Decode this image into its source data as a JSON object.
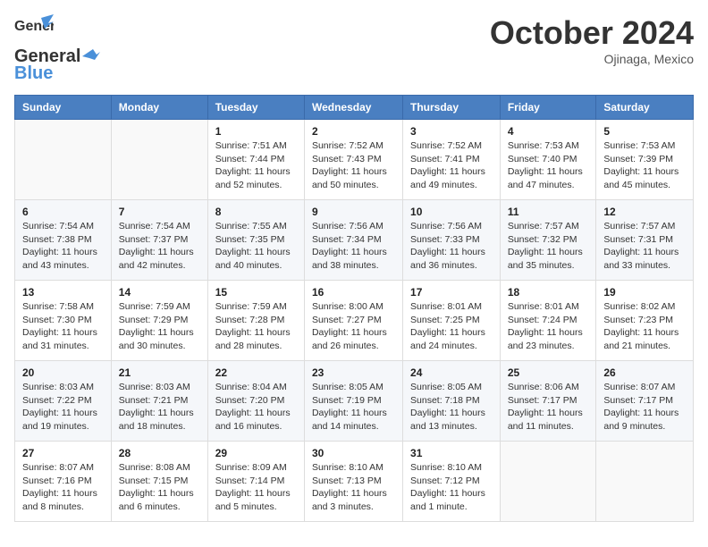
{
  "header": {
    "logo_line1": "General",
    "logo_line2": "Blue",
    "month_title": "October 2024",
    "location": "Ojinaga, Mexico"
  },
  "weekdays": [
    "Sunday",
    "Monday",
    "Tuesday",
    "Wednesday",
    "Thursday",
    "Friday",
    "Saturday"
  ],
  "weeks": [
    [
      {
        "day": "",
        "sunrise": "",
        "sunset": "",
        "daylight": ""
      },
      {
        "day": "",
        "sunrise": "",
        "sunset": "",
        "daylight": ""
      },
      {
        "day": "1",
        "sunrise": "Sunrise: 7:51 AM",
        "sunset": "Sunset: 7:44 PM",
        "daylight": "Daylight: 11 hours and 52 minutes."
      },
      {
        "day": "2",
        "sunrise": "Sunrise: 7:52 AM",
        "sunset": "Sunset: 7:43 PM",
        "daylight": "Daylight: 11 hours and 50 minutes."
      },
      {
        "day": "3",
        "sunrise": "Sunrise: 7:52 AM",
        "sunset": "Sunset: 7:41 PM",
        "daylight": "Daylight: 11 hours and 49 minutes."
      },
      {
        "day": "4",
        "sunrise": "Sunrise: 7:53 AM",
        "sunset": "Sunset: 7:40 PM",
        "daylight": "Daylight: 11 hours and 47 minutes."
      },
      {
        "day": "5",
        "sunrise": "Sunrise: 7:53 AM",
        "sunset": "Sunset: 7:39 PM",
        "daylight": "Daylight: 11 hours and 45 minutes."
      }
    ],
    [
      {
        "day": "6",
        "sunrise": "Sunrise: 7:54 AM",
        "sunset": "Sunset: 7:38 PM",
        "daylight": "Daylight: 11 hours and 43 minutes."
      },
      {
        "day": "7",
        "sunrise": "Sunrise: 7:54 AM",
        "sunset": "Sunset: 7:37 PM",
        "daylight": "Daylight: 11 hours and 42 minutes."
      },
      {
        "day": "8",
        "sunrise": "Sunrise: 7:55 AM",
        "sunset": "Sunset: 7:35 PM",
        "daylight": "Daylight: 11 hours and 40 minutes."
      },
      {
        "day": "9",
        "sunrise": "Sunrise: 7:56 AM",
        "sunset": "Sunset: 7:34 PM",
        "daylight": "Daylight: 11 hours and 38 minutes."
      },
      {
        "day": "10",
        "sunrise": "Sunrise: 7:56 AM",
        "sunset": "Sunset: 7:33 PM",
        "daylight": "Daylight: 11 hours and 36 minutes."
      },
      {
        "day": "11",
        "sunrise": "Sunrise: 7:57 AM",
        "sunset": "Sunset: 7:32 PM",
        "daylight": "Daylight: 11 hours and 35 minutes."
      },
      {
        "day": "12",
        "sunrise": "Sunrise: 7:57 AM",
        "sunset": "Sunset: 7:31 PM",
        "daylight": "Daylight: 11 hours and 33 minutes."
      }
    ],
    [
      {
        "day": "13",
        "sunrise": "Sunrise: 7:58 AM",
        "sunset": "Sunset: 7:30 PM",
        "daylight": "Daylight: 11 hours and 31 minutes."
      },
      {
        "day": "14",
        "sunrise": "Sunrise: 7:59 AM",
        "sunset": "Sunset: 7:29 PM",
        "daylight": "Daylight: 11 hours and 30 minutes."
      },
      {
        "day": "15",
        "sunrise": "Sunrise: 7:59 AM",
        "sunset": "Sunset: 7:28 PM",
        "daylight": "Daylight: 11 hours and 28 minutes."
      },
      {
        "day": "16",
        "sunrise": "Sunrise: 8:00 AM",
        "sunset": "Sunset: 7:27 PM",
        "daylight": "Daylight: 11 hours and 26 minutes."
      },
      {
        "day": "17",
        "sunrise": "Sunrise: 8:01 AM",
        "sunset": "Sunset: 7:25 PM",
        "daylight": "Daylight: 11 hours and 24 minutes."
      },
      {
        "day": "18",
        "sunrise": "Sunrise: 8:01 AM",
        "sunset": "Sunset: 7:24 PM",
        "daylight": "Daylight: 11 hours and 23 minutes."
      },
      {
        "day": "19",
        "sunrise": "Sunrise: 8:02 AM",
        "sunset": "Sunset: 7:23 PM",
        "daylight": "Daylight: 11 hours and 21 minutes."
      }
    ],
    [
      {
        "day": "20",
        "sunrise": "Sunrise: 8:03 AM",
        "sunset": "Sunset: 7:22 PM",
        "daylight": "Daylight: 11 hours and 19 minutes."
      },
      {
        "day": "21",
        "sunrise": "Sunrise: 8:03 AM",
        "sunset": "Sunset: 7:21 PM",
        "daylight": "Daylight: 11 hours and 18 minutes."
      },
      {
        "day": "22",
        "sunrise": "Sunrise: 8:04 AM",
        "sunset": "Sunset: 7:20 PM",
        "daylight": "Daylight: 11 hours and 16 minutes."
      },
      {
        "day": "23",
        "sunrise": "Sunrise: 8:05 AM",
        "sunset": "Sunset: 7:19 PM",
        "daylight": "Daylight: 11 hours and 14 minutes."
      },
      {
        "day": "24",
        "sunrise": "Sunrise: 8:05 AM",
        "sunset": "Sunset: 7:18 PM",
        "daylight": "Daylight: 11 hours and 13 minutes."
      },
      {
        "day": "25",
        "sunrise": "Sunrise: 8:06 AM",
        "sunset": "Sunset: 7:17 PM",
        "daylight": "Daylight: 11 hours and 11 minutes."
      },
      {
        "day": "26",
        "sunrise": "Sunrise: 8:07 AM",
        "sunset": "Sunset: 7:17 PM",
        "daylight": "Daylight: 11 hours and 9 minutes."
      }
    ],
    [
      {
        "day": "27",
        "sunrise": "Sunrise: 8:07 AM",
        "sunset": "Sunset: 7:16 PM",
        "daylight": "Daylight: 11 hours and 8 minutes."
      },
      {
        "day": "28",
        "sunrise": "Sunrise: 8:08 AM",
        "sunset": "Sunset: 7:15 PM",
        "daylight": "Daylight: 11 hours and 6 minutes."
      },
      {
        "day": "29",
        "sunrise": "Sunrise: 8:09 AM",
        "sunset": "Sunset: 7:14 PM",
        "daylight": "Daylight: 11 hours and 5 minutes."
      },
      {
        "day": "30",
        "sunrise": "Sunrise: 8:10 AM",
        "sunset": "Sunset: 7:13 PM",
        "daylight": "Daylight: 11 hours and 3 minutes."
      },
      {
        "day": "31",
        "sunrise": "Sunrise: 8:10 AM",
        "sunset": "Sunset: 7:12 PM",
        "daylight": "Daylight: 11 hours and 1 minute."
      },
      {
        "day": "",
        "sunrise": "",
        "sunset": "",
        "daylight": ""
      },
      {
        "day": "",
        "sunrise": "",
        "sunset": "",
        "daylight": ""
      }
    ]
  ]
}
